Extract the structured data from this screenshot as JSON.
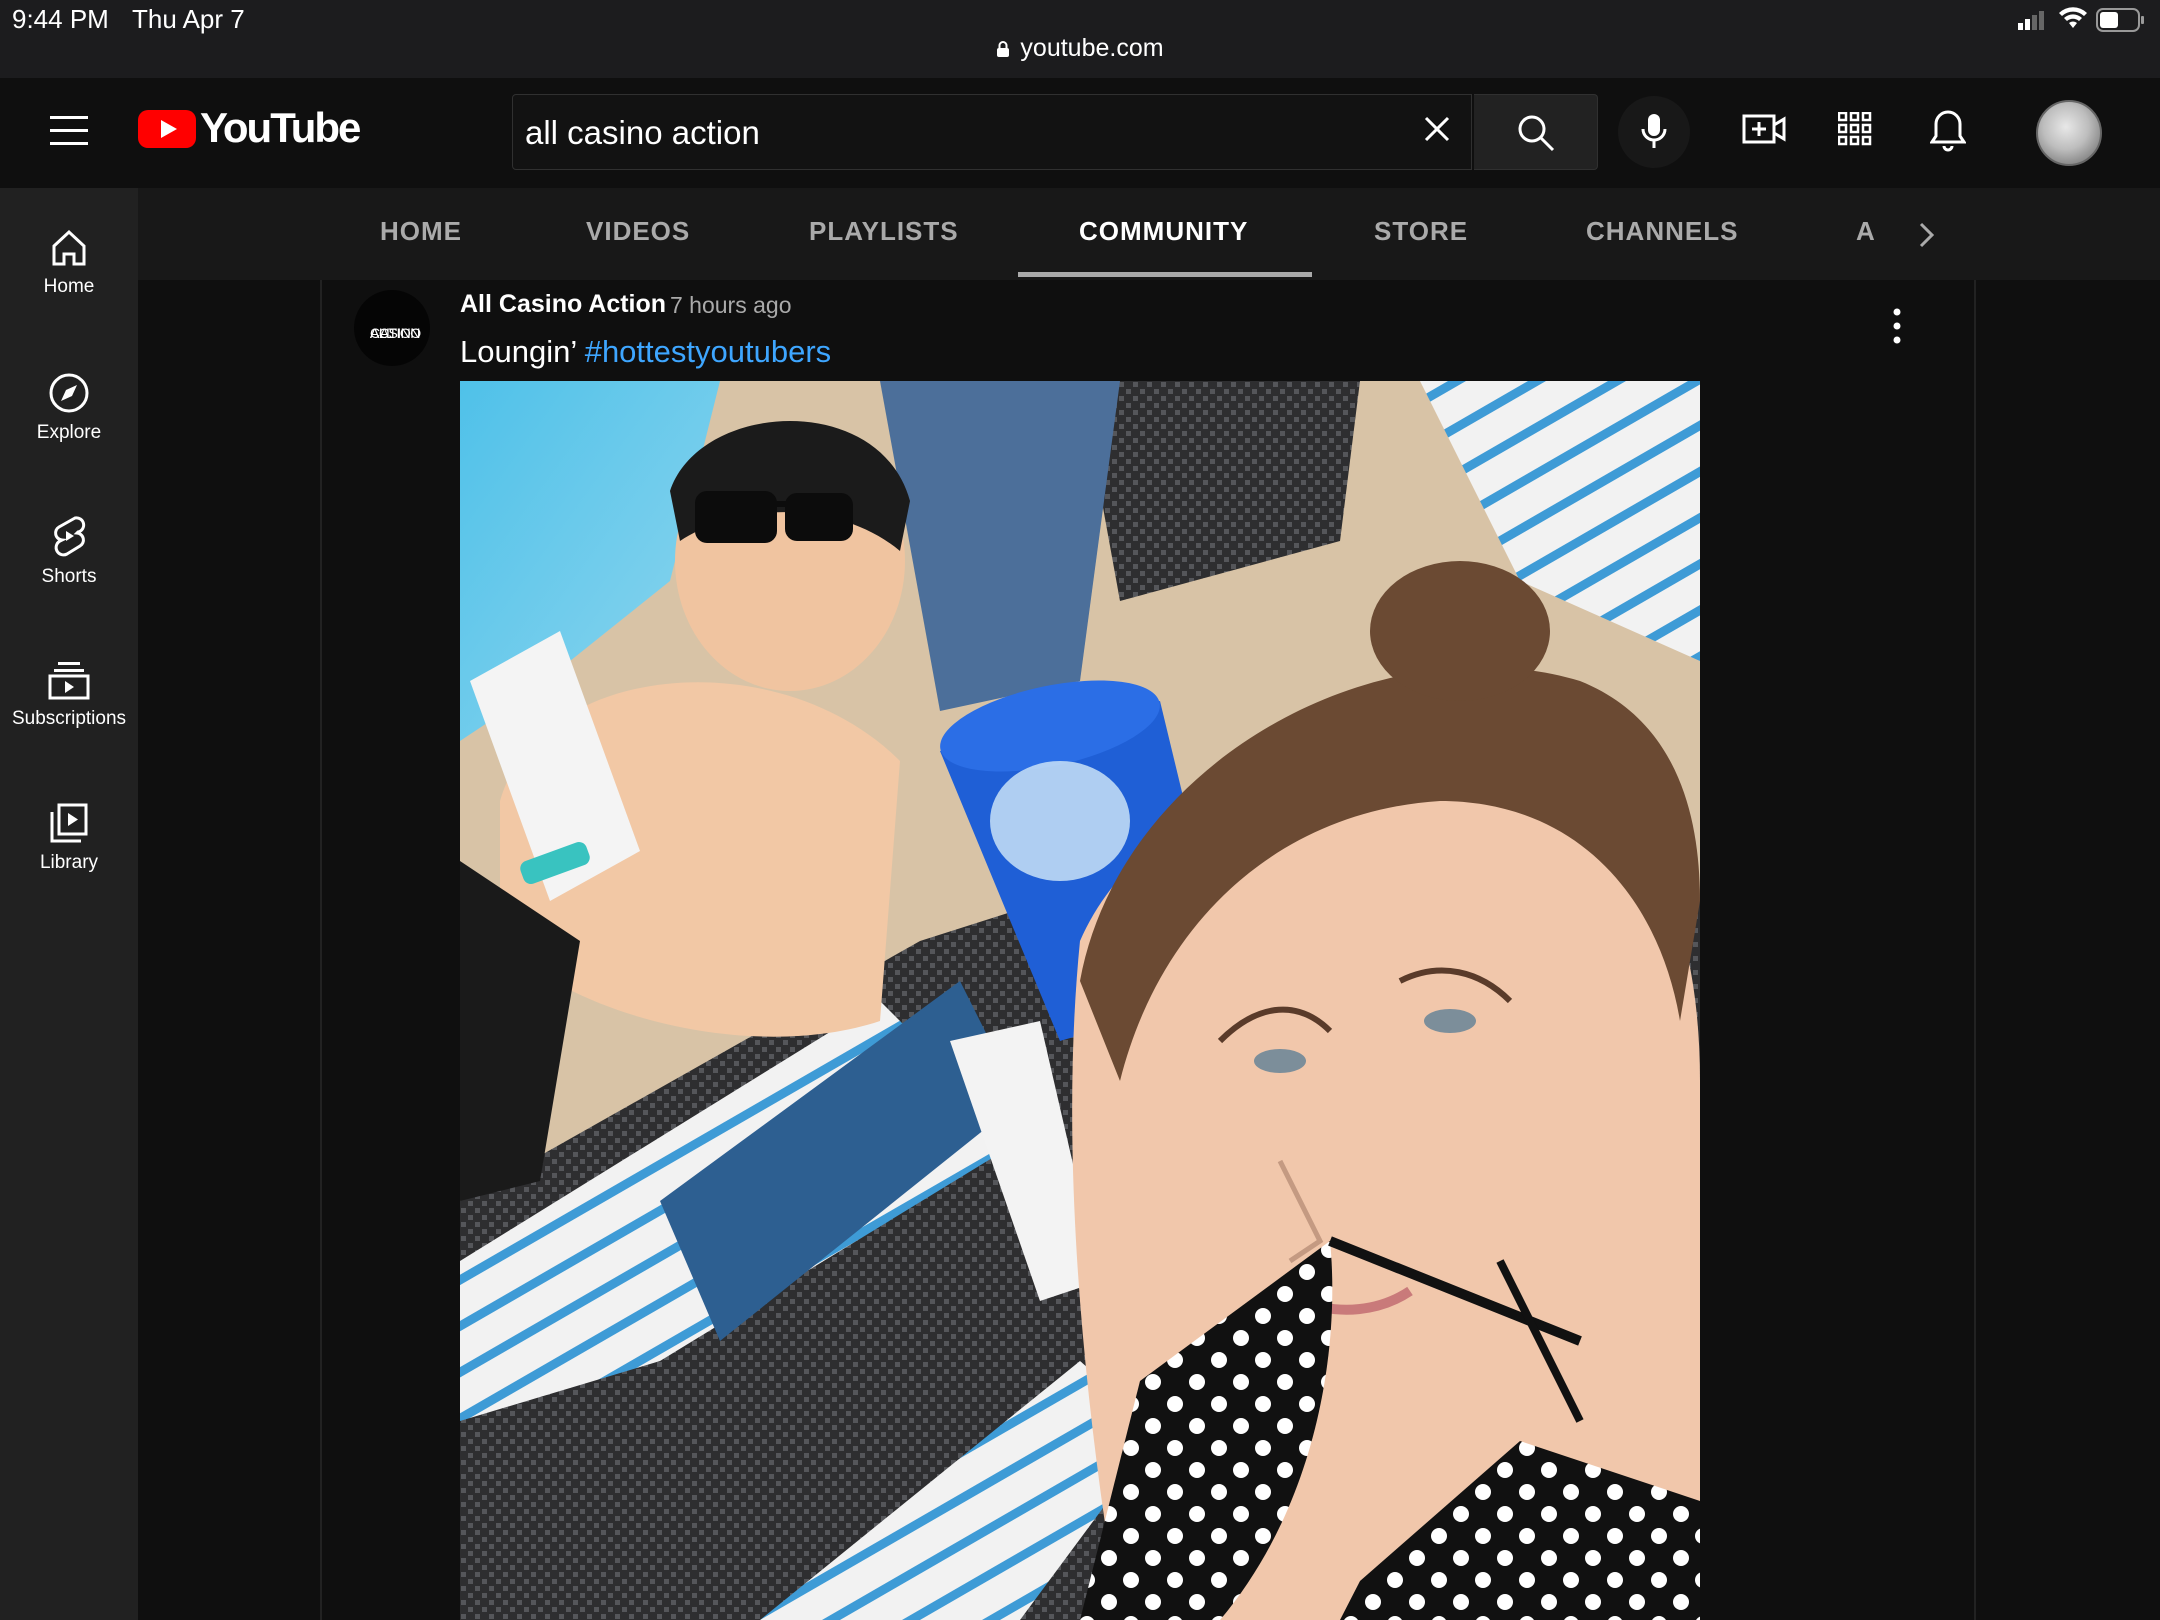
{
  "status_bar": {
    "time": "9:44 PM",
    "date": "Thu Apr 7",
    "url": "youtube.com"
  },
  "header": {
    "logo_text": "YouTube",
    "search": {
      "value": "all casino action",
      "placeholder": "Search"
    },
    "icons": [
      "menu-icon",
      "clear-icon",
      "search-icon",
      "mic-icon",
      "create-video-icon",
      "apps-icon",
      "notifications-icon"
    ]
  },
  "left_nav": {
    "items": [
      {
        "label": "Home",
        "icon": "home-icon"
      },
      {
        "label": "Explore",
        "icon": "compass-icon"
      },
      {
        "label": "Shorts",
        "icon": "shorts-icon"
      },
      {
        "label": "Subscriptions",
        "icon": "subscriptions-icon"
      },
      {
        "label": "Library",
        "icon": "library-icon"
      }
    ]
  },
  "channel_tabs": {
    "tabs": [
      "HOME",
      "VIDEOS",
      "PLAYLISTS",
      "COMMUNITY",
      "STORE",
      "CHANNELS",
      "A"
    ],
    "active": "COMMUNITY"
  },
  "post": {
    "avatar_text": [
      "ALL",
      "CASINO",
      "ACTION"
    ],
    "author": "All Casino Action",
    "time": "7 hours ago",
    "text": "Loungin’",
    "hashtag": "#hottestyoutubers"
  },
  "colors": {
    "background": "#0f0f0f",
    "brand_red": "#ff0000",
    "link_blue": "#3ea6ff",
    "secondary_text": "#aaaaaa"
  }
}
